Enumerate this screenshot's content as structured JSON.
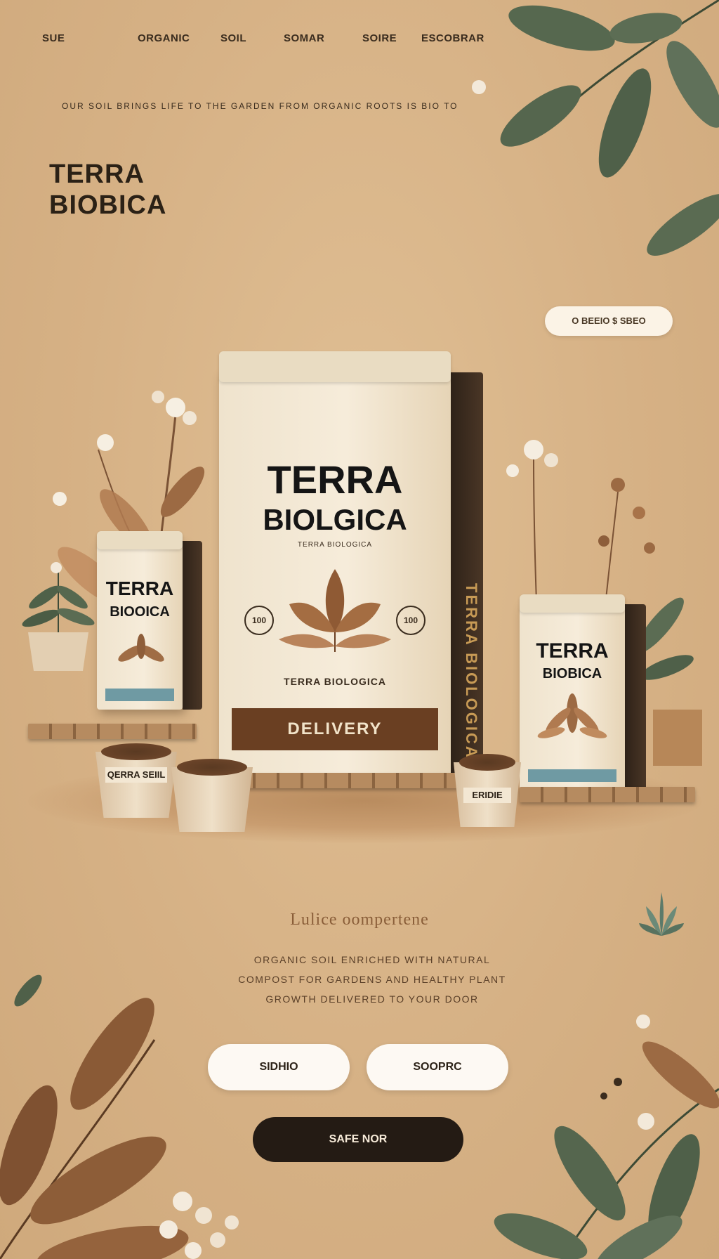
{
  "nav": {
    "items": [
      "SUE",
      "ORGANIC",
      "SOIL",
      "SOMAR",
      "SOIRE",
      "ESCOBRAR"
    ]
  },
  "tagline": "OUR SOIL BRINGS LIFE TO THE GARDEN FROM ORGANIC ROOTS IS BIO TO",
  "brand": {
    "line1": "TERRA",
    "line2": "BIOBICA"
  },
  "header_pill": {
    "label": "O  BEEIO   $ SBEO"
  },
  "products": {
    "main_bag": {
      "title_line1": "TERRA",
      "title_line2": "BIOLGICA",
      "subtitle": "TERRA BIOLOGICA",
      "badge_left": "100",
      "badge_right": "100",
      "caption": "TERRA BIOLOGICA",
      "band": "DELIVERY",
      "side_text": "TERRA BIOLOGICA"
    },
    "left_bag": {
      "title_line1": "TERRA",
      "title_line2": "BIOOICA"
    },
    "right_bag": {
      "title_line1": "TERRA",
      "title_line2": "BIOBICA"
    },
    "pot_left_label": "QERRA SEIIL",
    "pot_right_label": "ERIDIE"
  },
  "section": {
    "heading": "Lulice oompertene",
    "copy": "ORGANIC SOIL ENRICHED WITH NATURAL COMPOST FOR GARDENS AND HEALTHY PLANT GROWTH DELIVERED TO YOUR DOOR"
  },
  "buttons": {
    "primary_left": "SIDHIO",
    "primary_right": "SOOPRC",
    "cta": "SAFE NOR"
  },
  "colors": {
    "background": "#d8b487",
    "leaf_green": "#556b50",
    "leaf_brown": "#8a5a36",
    "bag_band": "#6a3f22",
    "cta_bg": "#241b14"
  }
}
